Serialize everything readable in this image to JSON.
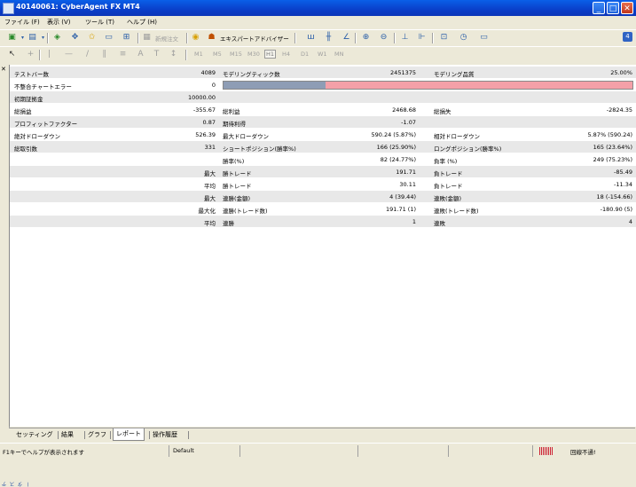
{
  "window": {
    "title": "40140061: CyberAgent FX MT4"
  },
  "menu": [
    {
      "label": "ファイル (F)"
    },
    {
      "label": "表示 (V)"
    },
    {
      "label": "ツール (T)"
    },
    {
      "label": "ヘルプ (H)"
    }
  ],
  "toolbar": {
    "new_order": "新規注文",
    "expert_advisors": "エキスパートアドバイザー",
    "periods": [
      "M1",
      "M5",
      "M15",
      "M30",
      "H1",
      "H4",
      "D1",
      "W1",
      "MN"
    ],
    "selected_period": "H1"
  },
  "report": {
    "row1": {
      "l1": "テストバー数",
      "v1": "4089",
      "l2": "モデリングティック数",
      "v2": "2451375",
      "l3": "モデリング品質",
      "v3": "25.00%"
    },
    "row2": {
      "l1": "不整合チャートエラー",
      "v1": "0",
      "modeling_quality_pct": 25
    },
    "row3": {
      "l1": "初期証拠金",
      "v1": "10000.00"
    },
    "row4": {
      "l1": "総損益",
      "v1": "-355.67",
      "l2": "総利益",
      "v2": "2468.68",
      "l3": "総損失",
      "v3": "-2824.35"
    },
    "row5": {
      "l1": "プロフィットファクター",
      "v1": "0.87",
      "l2": "期待利得",
      "v2": "-1.07"
    },
    "row6": {
      "l1": "絶対ドローダウン",
      "v1": "526.39",
      "l2": "最大ドローダウン",
      "v2": "590.24 (5.87%)",
      "l3": "相対ドローダウン",
      "v3": "5.87% (590.24)"
    },
    "row7": {
      "l1": "総取引数",
      "v1": "331",
      "l2": "ショートポジション(勝率%)",
      "v2": "166 (25.90%)",
      "l3": "ロングポジション(勝率%)",
      "v3": "165 (23.64%)"
    },
    "row8": {
      "l2": "勝率(%)",
      "v2": "82 (24.77%)",
      "l3": "負率 (%)",
      "v3": "249 (75.23%)"
    },
    "row9": {
      "l1": "最大",
      "l2": "勝トレード",
      "v2": "191.71",
      "l3": "負トレード",
      "v3": "-85.49"
    },
    "row10": {
      "l1": "平均",
      "l2": "勝トレード",
      "v2": "30.11",
      "l3": "負トレード",
      "v3": "-11.34"
    },
    "row11": {
      "l1": "最大",
      "l2": "連勝(金額)",
      "v2": "4 (39.44)",
      "l3": "連敗(金額)",
      "v3": "18 (-154.66)"
    },
    "row12": {
      "l1": "最大化",
      "l2": "連勝(トレード数)",
      "v2": "191.71 (1)",
      "l3": "連敗(トレード数)",
      "v3": "-180.90 (5)"
    },
    "row13": {
      "l1": "平均",
      "l2": "連勝",
      "v2": "1",
      "l3": "連敗",
      "v3": "4"
    }
  },
  "tabs": [
    {
      "label": "セッティング"
    },
    {
      "label": "結果"
    },
    {
      "label": "グラフ"
    },
    {
      "label": "レポート",
      "active": true
    },
    {
      "label": "操作履歴"
    }
  ],
  "side_label": "テスター",
  "status": {
    "help": "F1キーでヘルプが表示されます",
    "profile": "Default",
    "connection": "回線不通!"
  },
  "colors": {
    "quality_fill": "#8e9db5",
    "quality_bg": "#f4a0a8",
    "title_bar": "#0a5fe8"
  }
}
